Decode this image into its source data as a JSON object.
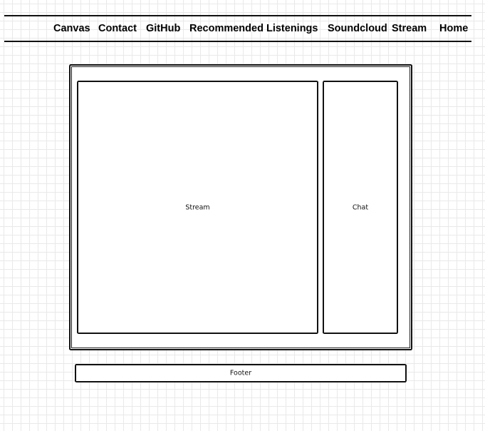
{
  "nav": {
    "items": [
      {
        "label": "Canvas"
      },
      {
        "label": "Contact"
      },
      {
        "label": "GitHub"
      },
      {
        "label": "Recommended Listenings"
      },
      {
        "label": "Soundcloud"
      },
      {
        "label": "Stream"
      },
      {
        "label": "Home"
      }
    ]
  },
  "layout": {
    "stream_label": "Stream",
    "chat_label": "Chat",
    "footer_label": "Footer"
  }
}
